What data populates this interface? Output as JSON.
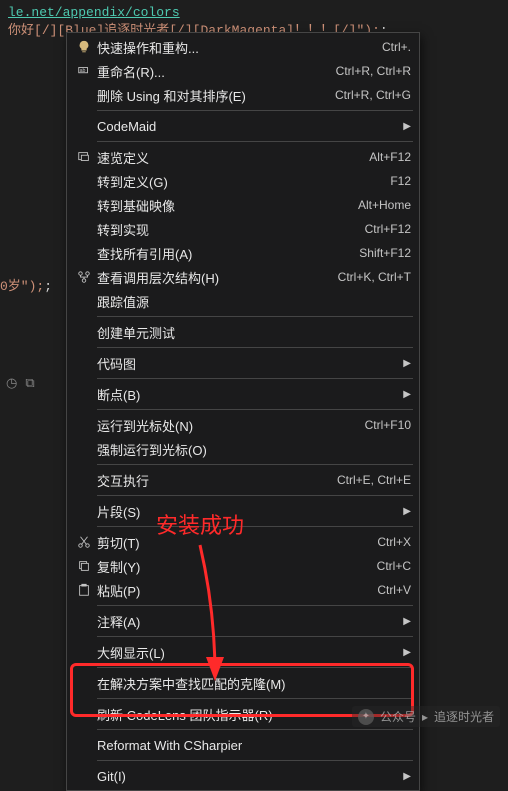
{
  "code": {
    "line1": "le.net/appendix/colors",
    "line2_prefix": "你好",
    "line2_seg1": "[/][Blue]",
    "line2_mid1": "追逐时光者",
    "line2_seg2": "[/][DarkMagenta]",
    "line2_tail": "！！！[/]\");",
    "extra": "0岁\");"
  },
  "annotation": "安装成功",
  "menu": {
    "items": [
      {
        "icon": "bulb",
        "label": "快速操作和重构...",
        "shortcut": "Ctrl+."
      },
      {
        "icon": "tag",
        "label": "重命名(R)...",
        "shortcut": "Ctrl+R, Ctrl+R"
      },
      {
        "icon": "",
        "label": "删除 Using 和对其排序(E)",
        "shortcut": "Ctrl+R, Ctrl+G"
      },
      {
        "sep": true
      },
      {
        "icon": "",
        "label": "CodeMaid",
        "submenu": true
      },
      {
        "sep": true
      },
      {
        "icon": "peek",
        "label": "速览定义",
        "shortcut": "Alt+F12"
      },
      {
        "icon": "",
        "label": "转到定义(G)",
        "shortcut": "F12"
      },
      {
        "icon": "",
        "label": "转到基础映像",
        "shortcut": "Alt+Home"
      },
      {
        "icon": "",
        "label": "转到实现",
        "shortcut": "Ctrl+F12"
      },
      {
        "icon": "",
        "label": "查找所有引用(A)",
        "shortcut": "Shift+F12"
      },
      {
        "icon": "hierarchy",
        "label": "查看调用层次结构(H)",
        "shortcut": "Ctrl+K, Ctrl+T"
      },
      {
        "icon": "",
        "label": "跟踪值源"
      },
      {
        "sep": true
      },
      {
        "icon": "",
        "label": "创建单元测试"
      },
      {
        "sep": true
      },
      {
        "icon": "",
        "label": "代码图",
        "submenu": true
      },
      {
        "sep": true
      },
      {
        "icon": "",
        "label": "断点(B)",
        "submenu": true
      },
      {
        "sep": true
      },
      {
        "icon": "",
        "label": "运行到光标处(N)",
        "shortcut": "Ctrl+F10"
      },
      {
        "icon": "",
        "label": "强制运行到光标(O)"
      },
      {
        "sep": true
      },
      {
        "icon": "",
        "label": "交互执行",
        "shortcut": "Ctrl+E, Ctrl+E"
      },
      {
        "sep": true
      },
      {
        "icon": "",
        "label": "片段(S)",
        "submenu": true
      },
      {
        "sep": true
      },
      {
        "icon": "cut",
        "label": "剪切(T)",
        "shortcut": "Ctrl+X"
      },
      {
        "icon": "copy",
        "label": "复制(Y)",
        "shortcut": "Ctrl+C"
      },
      {
        "icon": "paste",
        "label": "粘贴(P)",
        "shortcut": "Ctrl+V"
      },
      {
        "sep": true
      },
      {
        "icon": "",
        "label": "注释(A)",
        "submenu": true
      },
      {
        "sep": true
      },
      {
        "icon": "",
        "label": "大纲显示(L)",
        "submenu": true
      },
      {
        "sep": true
      },
      {
        "icon": "",
        "label": "在解决方案中查找匹配的克隆(M)"
      },
      {
        "sep": true
      },
      {
        "icon": "",
        "label": "刷新 CodeLens 团队指示器(R)"
      },
      {
        "sep": true
      },
      {
        "icon": "",
        "label": "Reformat With CSharpier"
      },
      {
        "sep": true
      },
      {
        "icon": "",
        "label": "Git(I)",
        "submenu": true
      }
    ]
  },
  "watermark": {
    "prefix": "公众号",
    "name": "追逐时光者"
  },
  "side_icons": {
    "clock": "◷",
    "copy": "⧉"
  }
}
